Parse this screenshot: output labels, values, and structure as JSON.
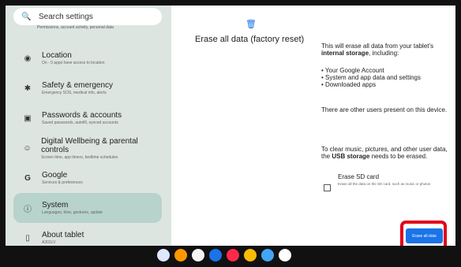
{
  "search": {
    "placeholder": "Search settings"
  },
  "top_cut_text": "Permissions, account activity, personal data",
  "sidebar": {
    "items": [
      {
        "name": "location",
        "title": "Location",
        "subtitle": "On - 0 apps have access to location"
      },
      {
        "name": "safety",
        "title": "Safety & emergency",
        "subtitle": "Emergency SOS, medical info, alerts"
      },
      {
        "name": "passwords",
        "title": "Passwords & accounts",
        "subtitle": "Saved passwords, autofill, synced accounts"
      },
      {
        "name": "wellbeing",
        "title": "Digital Wellbeing & parental controls",
        "subtitle": "Screen time, app timers, bedtime schedules"
      },
      {
        "name": "google",
        "title": "Google",
        "subtitle": "Services & preferences"
      },
      {
        "name": "system",
        "title": "System",
        "subtitle": "Languages, time, gestures, update"
      },
      {
        "name": "about",
        "title": "About tablet",
        "subtitle": "A301LV"
      }
    ]
  },
  "main": {
    "title": "Erase all data (factory reset)",
    "intro_prefix": "This will erase all data from your tablet’s",
    "intro_bold": "internal storage",
    "intro_suffix": ", including:",
    "bullets": [
      "Your Google Account",
      "System and app data and settings",
      "Downloaded apps"
    ],
    "other_users": "There are other users present on this device.",
    "usb_prefix": "To clear music, pictures, and other user data, the",
    "usb_bold": "USB storage",
    "usb_suffix": "needs to be erased.",
    "sd_label": "Erase SD card",
    "sd_sub": "Erase all the data on the SD card, such as music or photos",
    "erase_button": "Erase all data"
  },
  "colors": {
    "accent": "#1a73e8",
    "highlight": "#e1001a",
    "sidebar_bg": "#dde5e0",
    "selected_bg": "#b7d3cc"
  }
}
